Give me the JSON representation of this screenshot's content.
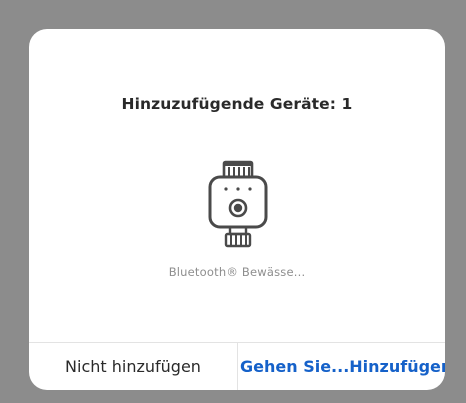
{
  "dialog": {
    "title": "Hinzuzufügende Geräte: 1",
    "device": {
      "icon": "bluetooth-water-timer-icon",
      "label": "Bluetooth® Bewässe..."
    },
    "buttons": {
      "cancel_label": "Nicht hinzufügen",
      "confirm_label": "Gehen Sie...Hinzufügen"
    }
  },
  "colors": {
    "overlay": "#8c8c8c",
    "dialog_bg": "#ffffff",
    "accent": "#1561c9",
    "title_text": "#2a2a2a",
    "label_text": "#8e8e8e",
    "divider": "#e3e3e3"
  }
}
